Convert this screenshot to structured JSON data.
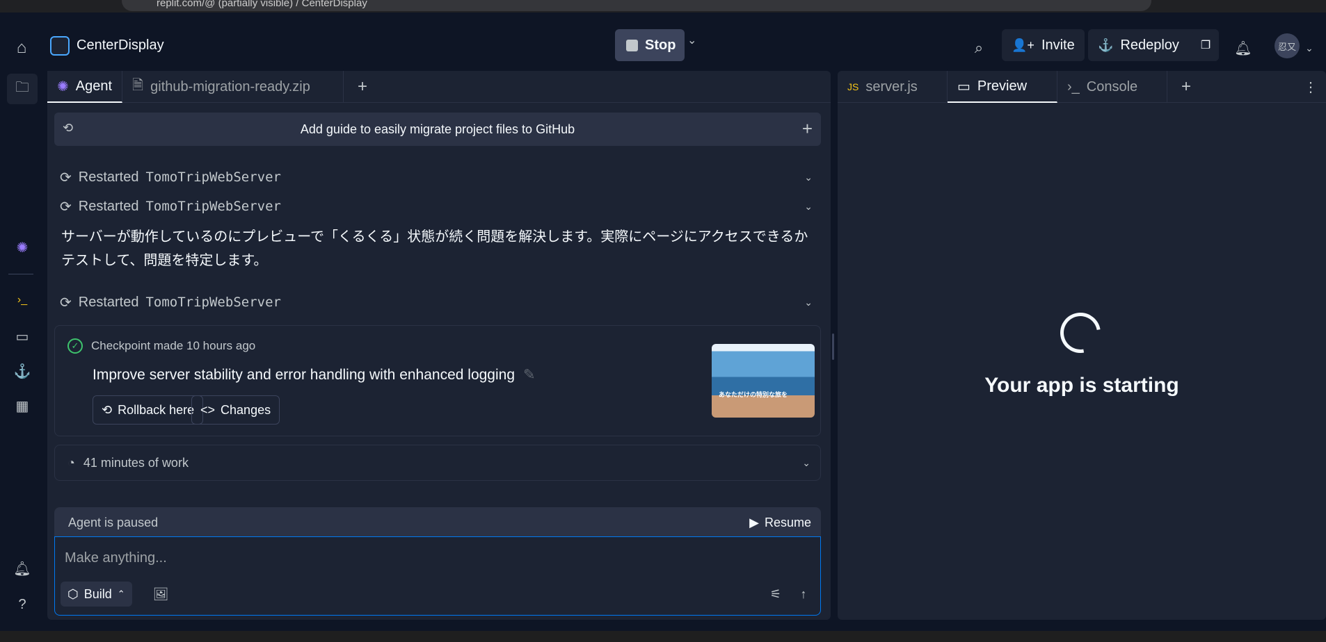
{
  "browser": {
    "url": "replit.com/@ (partially visible) / CenterDisplay"
  },
  "header": {
    "app_name": "CenterDisplay",
    "stop_label": "Stop",
    "invite_label": "Invite",
    "redeploy_label": "Redeploy",
    "avatar_text": "忍又"
  },
  "left_tabs": {
    "agent": "Agent",
    "zip": "github-migration-ready.zip"
  },
  "right_tabs": {
    "server": "server.js",
    "preview": "Preview",
    "console": "Console"
  },
  "chat": {
    "guide_text": "Add guide to easily migrate project files to GitHub",
    "restart_prefix": "Restarted",
    "restart_target": "TomoTripWebServer",
    "message": "サーバーが動作しているのにプレビューで「くるくる」状態が続く問題を解決します。実際にページにアクセスできるかテストして、問題を特定します。",
    "checkpoint": {
      "head": "Checkpoint made 10 hours ago",
      "title": "Improve server stability and error handling with enhanced logging",
      "rollback": "Rollback here",
      "changes": "Changes",
      "thumb_text": "あなただけの特別な旅を"
    },
    "work": "41 minutes of work",
    "paused": "Agent is paused",
    "resume": "Resume",
    "placeholder": "Make anything...",
    "build": "Build"
  },
  "preview": {
    "status": "Your app is starting"
  }
}
